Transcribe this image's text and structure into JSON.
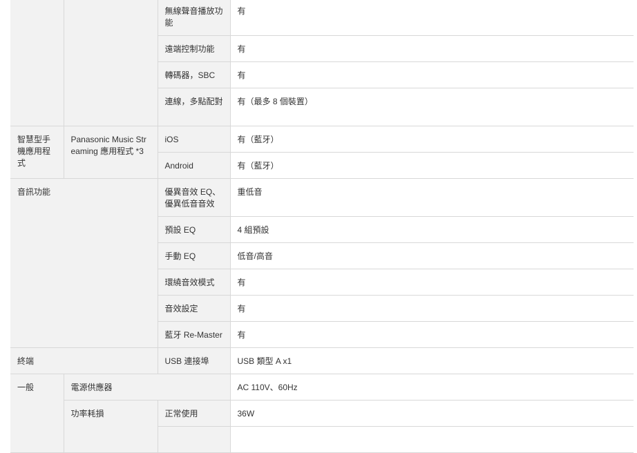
{
  "rows": {
    "wireless_playback": {
      "label": "無線聲音播放功能",
      "value": "有"
    },
    "remote_control": {
      "label": "遠端控制功能",
      "value": "有"
    },
    "codec": {
      "label": "轉碼器，SBC",
      "value": "有"
    },
    "multipoint": {
      "label": "連線，多點配對",
      "value": "有（最多 8 個裝置）"
    },
    "smartphone_app": {
      "category": "智慧型手機應用程式",
      "app_name": "Panasonic Music Streaming 應用程式 *3",
      "ios": {
        "label": "iOS",
        "value": "有（藍牙）"
      },
      "android": {
        "label": "Android",
        "value": "有（藍牙）"
      }
    },
    "audio": {
      "category": "音訊功能",
      "items": [
        {
          "label": "優異音效 EQ、優異低音音效",
          "value": "重低音"
        },
        {
          "label": "預設 EQ",
          "value": "4 組預設"
        },
        {
          "label": "手動 EQ",
          "value": "低音/高音"
        },
        {
          "label": "環繞音效模式",
          "value": "有"
        },
        {
          "label": "音效設定",
          "value": "有"
        },
        {
          "label": "藍牙 Re-Master",
          "value": "有"
        }
      ]
    },
    "terminal": {
      "category": "終端",
      "label": "USB 連接埠",
      "value": "USB 類型 A x1"
    },
    "general": {
      "category": "一般",
      "power_supply": {
        "label": "電源供應器",
        "value": "AC 110V、60Hz"
      },
      "power_consumption": {
        "label": "功率耗損",
        "sub_label": "正常使用",
        "value": "36W"
      }
    }
  }
}
